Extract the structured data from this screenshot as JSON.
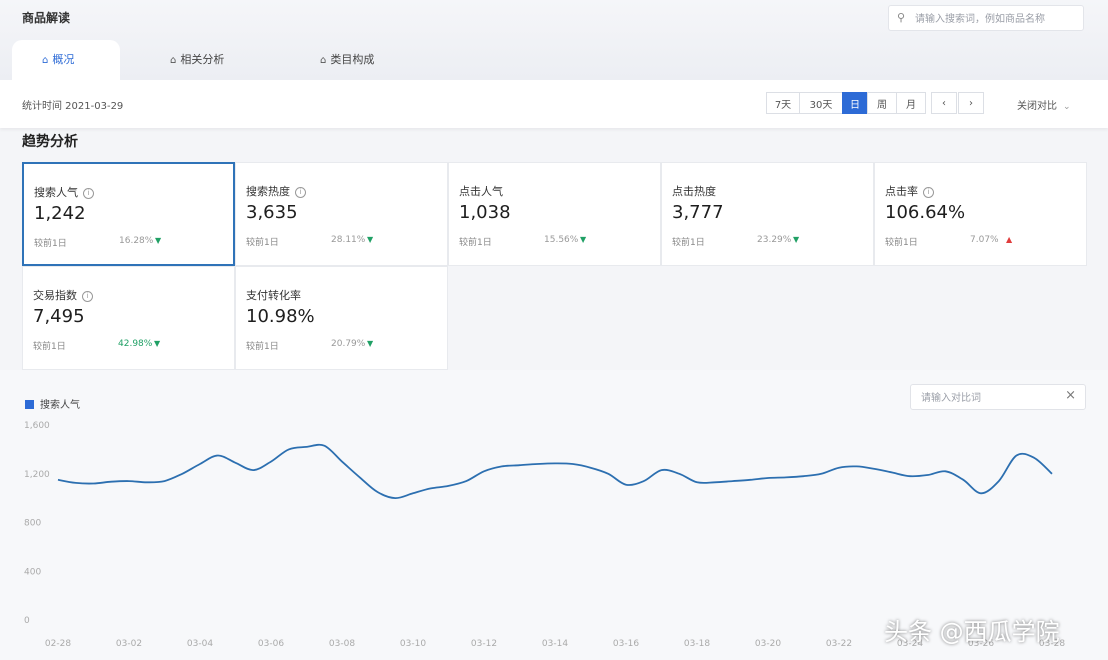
{
  "header": {
    "title": "商品解读",
    "search_placeholder": "请输入搜索词，例如商品名称",
    "search_icon": "search-icon"
  },
  "tabs": [
    {
      "label": "概况",
      "icon": "home-icon",
      "active": true
    },
    {
      "label": "相关分析",
      "icon": "home-icon",
      "active": false
    },
    {
      "label": "类目构成",
      "icon": "home-icon",
      "active": false
    }
  ],
  "toolbar": {
    "stat_date": "统计时间 2021-03-29",
    "periods": [
      {
        "label": "7天",
        "active": false
      },
      {
        "label": "30天",
        "active": false
      },
      {
        "label": "日",
        "active": true
      },
      {
        "label": "周",
        "active": false
      },
      {
        "label": "月",
        "active": false
      }
    ],
    "prev_icon": "‹",
    "next_icon": "›",
    "export_label": "关闭对比"
  },
  "section": {
    "title": "趋势分析"
  },
  "metrics": [
    {
      "label": "搜索人气",
      "value": "1,242",
      "compare": "较前1日",
      "pct": "16.28%",
      "trend": "down",
      "info": true,
      "selected": true
    },
    {
      "label": "搜索热度",
      "value": "3,635",
      "compare": "较前1日",
      "pct": "28.11%",
      "trend": "down",
      "info": true,
      "selected": false
    },
    {
      "label": "点击人气",
      "value": "1,038",
      "compare": "较前1日",
      "pct": "15.56%",
      "trend": "down",
      "info": false,
      "selected": false
    },
    {
      "label": "点击热度",
      "value": "3,777",
      "compare": "较前1日",
      "pct": "23.29%",
      "trend": "down",
      "info": false,
      "selected": false
    },
    {
      "label": "点击率",
      "value": "106.64%",
      "compare": "较前1日",
      "pct": "7.07%",
      "trend": "up",
      "info": true,
      "selected": false
    },
    {
      "label": "交易指数",
      "value": "7,495",
      "compare": "较前1日",
      "pct": "42.98%",
      "trend": "down",
      "info": true,
      "selected": false
    },
    {
      "label": "支付转化率",
      "value": "10.98%",
      "compare": "较前1日",
      "pct": "20.79%",
      "trend": "down",
      "info": false,
      "selected": false
    }
  ],
  "chart_panel": {
    "compare_placeholder": "请输入对比词",
    "close_icon": "×"
  },
  "chart_data": {
    "type": "line",
    "legend": "top-left",
    "grid": false,
    "series": [
      {
        "name": "搜索人气",
        "color": "#2c6fb0",
        "values": [
          1150,
          1125,
          1120,
          1135,
          1140,
          1130,
          1140,
          1200,
          1280,
          1350,
          1290,
          1230,
          1300,
          1400,
          1420,
          1430,
          1300,
          1170,
          1050,
          1000,
          1040,
          1080,
          1100,
          1140,
          1220,
          1260,
          1270,
          1280,
          1285,
          1280,
          1250,
          1200,
          1110,
          1140,
          1230,
          1200,
          1130,
          1130,
          1140,
          1150,
          1165,
          1170,
          1180,
          1200,
          1250,
          1260,
          1240,
          1210,
          1180,
          1190,
          1220,
          1150,
          1040,
          1140,
          1350,
          1330,
          1200
        ]
      }
    ],
    "y_ticks": [
      "1,600",
      "1,200",
      "800",
      "400",
      "0"
    ],
    "ylim": [
      0,
      1600
    ],
    "x_ticks": [
      "02-28",
      "03-02",
      "03-04",
      "03-06",
      "03-08",
      "03-10",
      "03-12",
      "03-14",
      "03-16",
      "03-18",
      "03-20",
      "03-22",
      "03-24",
      "03-26",
      "03-28"
    ]
  },
  "watermark": "头条 @西瓜学院"
}
